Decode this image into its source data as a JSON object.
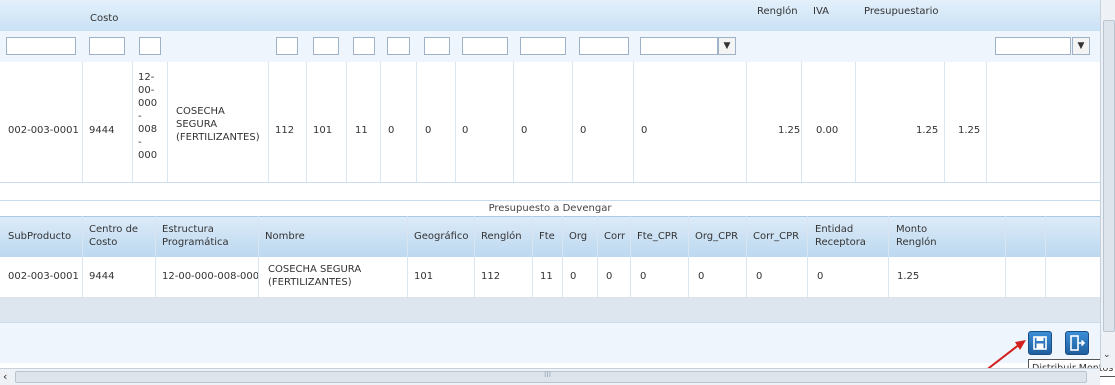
{
  "top_grid": {
    "headers": {
      "costo": "Costo",
      "renglon": "Renglón",
      "iva": "IVA",
      "presupuestario": "Presupuestario"
    },
    "row": {
      "subproducto": "002-003-0001",
      "centro_costo": "9444",
      "estructura": "12-\n00-\n000\n-\n008\n-\n000",
      "nombre": "COSECHA\nSEGURA\n(FERTILIZANTES)",
      "renglon": "112",
      "geografico": "101",
      "fte": "11",
      "org": "0",
      "corr": "0",
      "fte_cpr": "0",
      "org_cpr": "0",
      "corr_cpr": "0",
      "entidad": "0",
      "monto_renglon": "1.25",
      "iva": "0.00",
      "monto_presupuestario": "1.25",
      "extra": "1.25"
    }
  },
  "lower_grid": {
    "caption": "Presupuesto a Devengar",
    "headers": {
      "subproducto": "SubProducto",
      "centro": "Centro de\nCosto",
      "estructura": "Estructura\nProgramática",
      "nombre": "Nombre",
      "geografico": "Geográfico",
      "renglon": "Renglón",
      "fte": "Fte",
      "org": "Org",
      "corr": "Corr",
      "fte_cpr": "Fte_CPR",
      "org_cpr": "Org_CPR",
      "corr_cpr": "Corr_CPR",
      "entidad": "Entidad\nReceptora",
      "monto": "Monto\nRenglón"
    },
    "row": {
      "subproducto": "002-003-0001",
      "centro": "9444",
      "estructura": "12-00-000-008-000",
      "nombre": "COSECHA SEGURA\n(FERTILIZANTES)",
      "geografico": "101",
      "renglon": "112",
      "fte": "11",
      "org": "0",
      "corr": "0",
      "fte_cpr": "0",
      "org_cpr": "0",
      "corr_cpr": "0",
      "entidad": "0",
      "monto": "1.25"
    }
  },
  "toolbar": {
    "tooltip": "Distribuir Montos",
    "save_icon": "save-icon",
    "exit_icon": "exit-icon"
  },
  "scrollbar": {
    "grip": "III"
  },
  "colors": {
    "header_blue": "#c9e1f5",
    "button_blue": "#2a72bd",
    "arrow_red": "#d22020"
  }
}
